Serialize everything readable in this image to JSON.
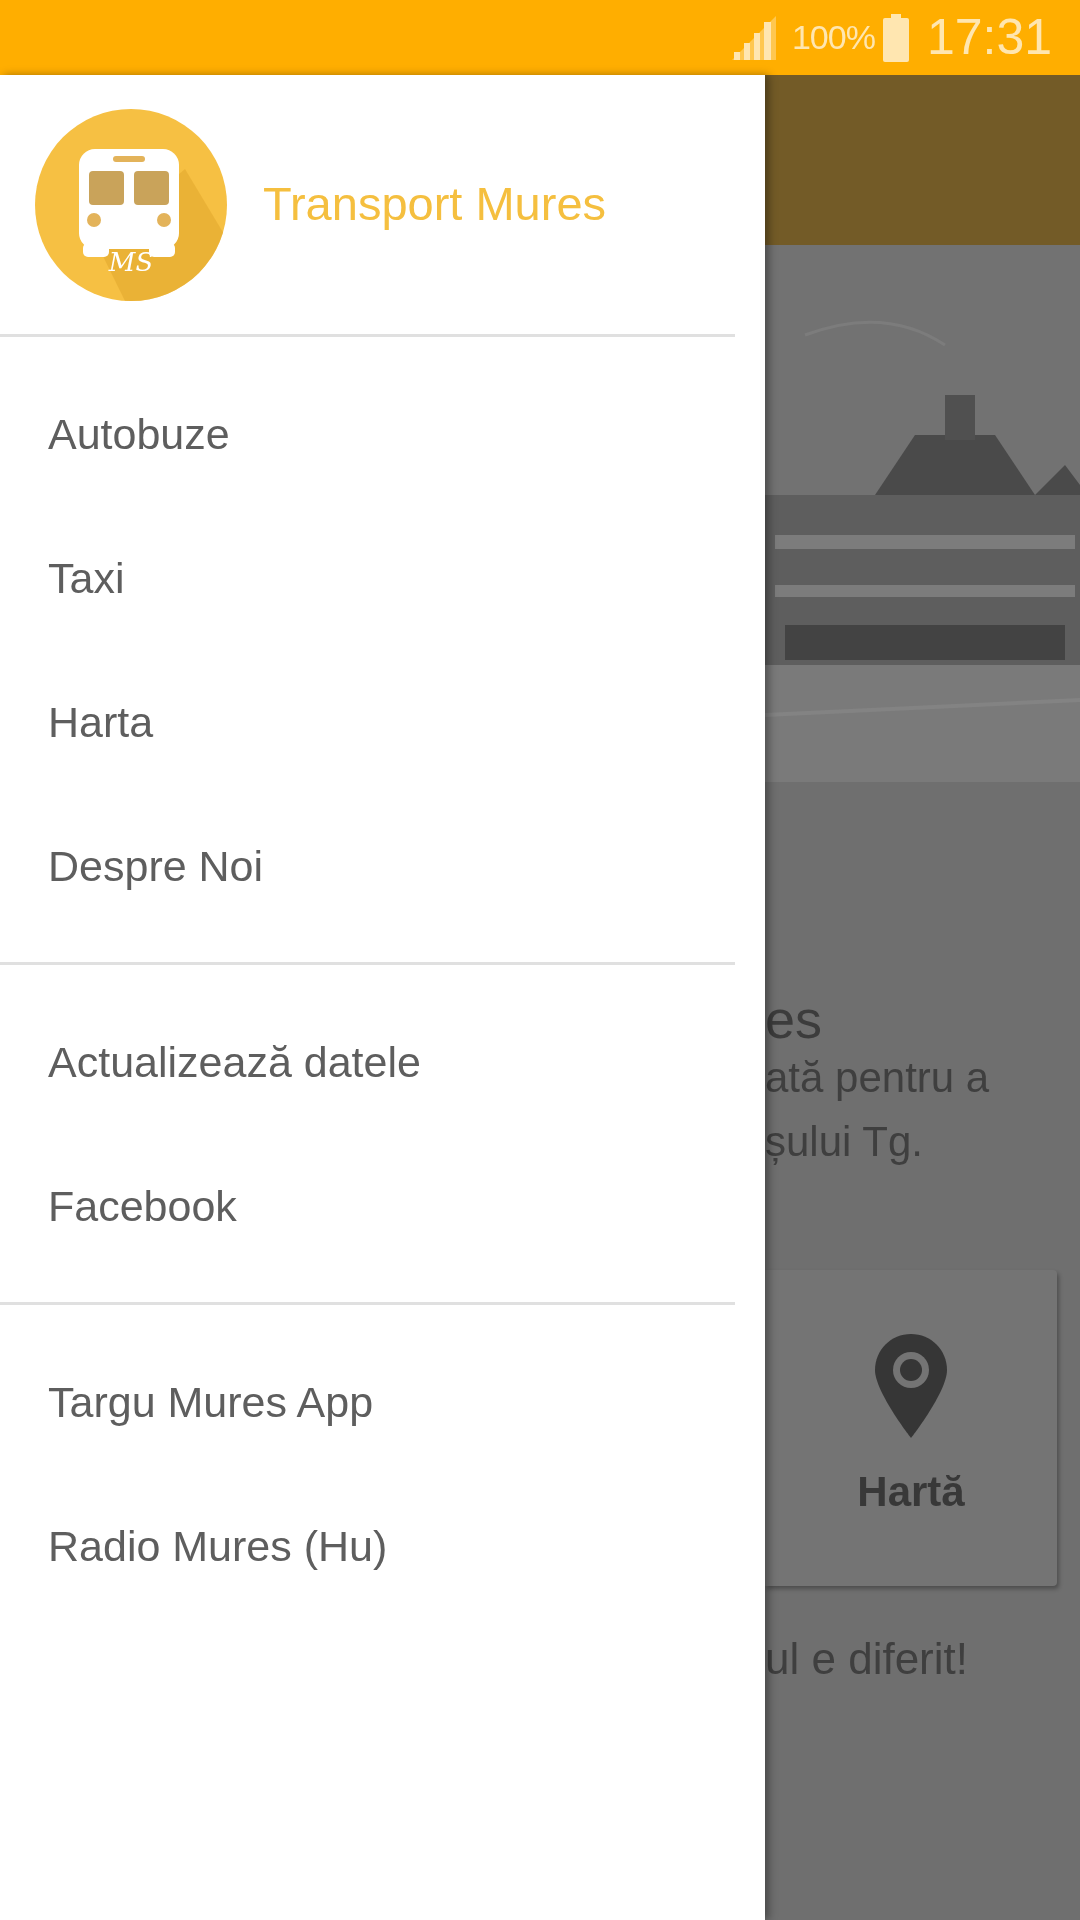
{
  "status_bar": {
    "battery": "100%",
    "time": "17:31"
  },
  "drawer": {
    "logo_text": "MS",
    "title": "Transport Mures",
    "sections": [
      {
        "items": [
          {
            "label": "Autobuze"
          },
          {
            "label": "Taxi"
          },
          {
            "label": "Harta"
          },
          {
            "label": "Despre Noi"
          }
        ]
      },
      {
        "items": [
          {
            "label": "Actualizează datele"
          },
          {
            "label": "Facebook"
          }
        ]
      },
      {
        "items": [
          {
            "label": "Targu Mures App"
          },
          {
            "label": "Radio Mures (Hu)"
          }
        ]
      }
    ]
  },
  "background": {
    "picture": {
      "kind": "picture"
    },
    "heading": "es",
    "lines": [
      "ată pentru a",
      "șului Tg."
    ],
    "card": {
      "label": "Hartă"
    },
    "footer": "ul e diferit!"
  }
}
